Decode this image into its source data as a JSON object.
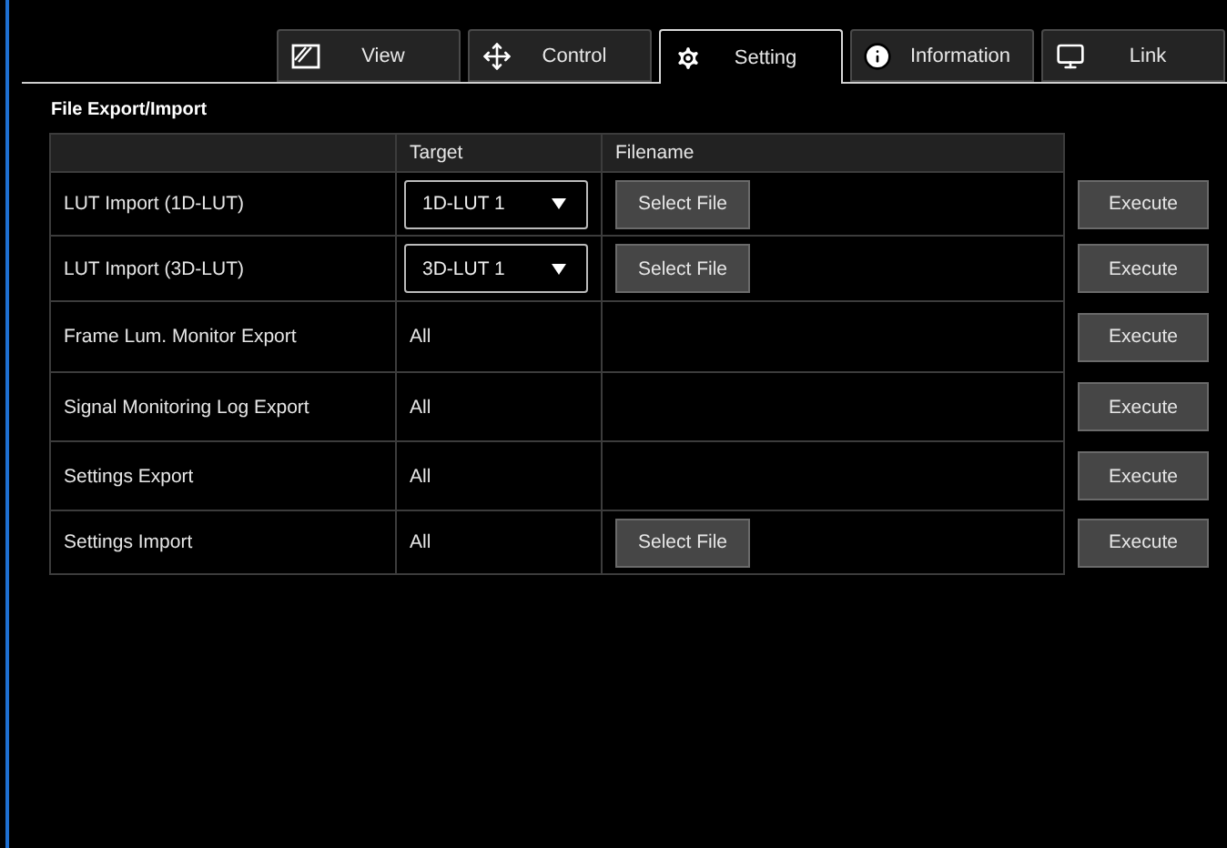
{
  "tabs": [
    {
      "label": "View",
      "selected": false
    },
    {
      "label": "Control",
      "selected": false
    },
    {
      "label": "Setting",
      "selected": true
    },
    {
      "label": "Information",
      "selected": false
    },
    {
      "label": "Link",
      "selected": false
    }
  ],
  "section_title": "File Export/Import",
  "table": {
    "columns": [
      "",
      "Target",
      "Filename"
    ],
    "rows": [
      {
        "name": "LUT Import (1D-LUT)",
        "target": {
          "kind": "dropdown",
          "value": "1D-LUT 1"
        },
        "filename_button": "Select File",
        "action": "Execute"
      },
      {
        "name": "LUT Import (3D-LUT)",
        "target": {
          "kind": "dropdown",
          "value": "3D-LUT 1"
        },
        "filename_button": "Select File",
        "action": "Execute"
      },
      {
        "name": "Frame Lum. Monitor Export",
        "target": {
          "kind": "text",
          "value": "All"
        },
        "action": "Execute"
      },
      {
        "name": "Signal Monitoring Log Export",
        "target": {
          "kind": "text",
          "value": "All"
        },
        "action": "Execute"
      },
      {
        "name": "Settings Export",
        "target": {
          "kind": "text",
          "value": "All"
        },
        "action": "Execute"
      },
      {
        "name": "Settings Import",
        "target": {
          "kind": "text",
          "value": "All"
        },
        "filename_button": "Select File",
        "action": "Execute"
      }
    ]
  }
}
